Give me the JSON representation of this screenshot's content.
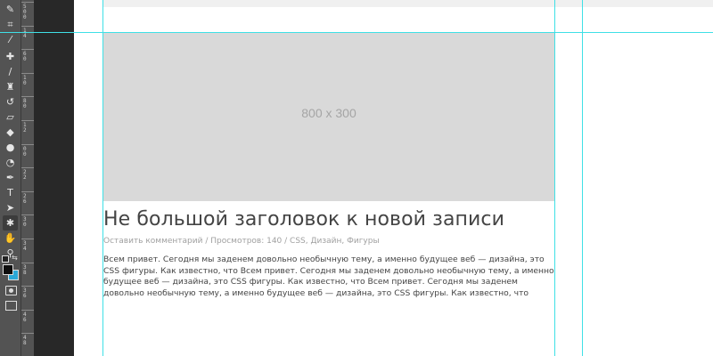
{
  "toolbar": {
    "tools": [
      {
        "name": "brush-small-icon",
        "glyph": "✎"
      },
      {
        "name": "crop-icon",
        "glyph": "⌗"
      },
      {
        "name": "eyedropper-icon",
        "glyph": "⁄"
      },
      {
        "name": "healing-brush-icon",
        "glyph": "✚"
      },
      {
        "name": "brush-icon",
        "glyph": "/"
      },
      {
        "name": "clone-stamp-icon",
        "glyph": "♜"
      },
      {
        "name": "history-brush-icon",
        "glyph": "↺"
      },
      {
        "name": "eraser-icon",
        "glyph": "▱"
      },
      {
        "name": "paint-bucket-icon",
        "glyph": "◆"
      },
      {
        "name": "blur-icon",
        "glyph": "●"
      },
      {
        "name": "dodge-icon",
        "glyph": "◔"
      },
      {
        "name": "pen-icon",
        "glyph": "✒"
      },
      {
        "name": "type-icon",
        "glyph": "T"
      },
      {
        "name": "path-selection-icon",
        "glyph": "➤"
      },
      {
        "name": "custom-shape-icon",
        "glyph": "✱"
      },
      {
        "name": "hand-icon",
        "glyph": "✋"
      },
      {
        "name": "zoom-icon",
        "glyph": "⚲"
      }
    ]
  },
  "ruler": {
    "ticks": [
      {
        "label": "5\n0\n0"
      },
      {
        "label": "1\n4"
      },
      {
        "label": "6\n0"
      },
      {
        "label": "1\n0"
      },
      {
        "label": "8\n0"
      },
      {
        "label": "1\n2"
      },
      {
        "label": "0\n0"
      },
      {
        "label": "2\n2"
      },
      {
        "label": "2\n6"
      },
      {
        "label": "3\n0"
      },
      {
        "label": "3\n4"
      },
      {
        "label": "3\n8"
      },
      {
        "label": "3\n6"
      },
      {
        "label": "4\n6"
      },
      {
        "label": "4\n8"
      }
    ]
  },
  "colors": {
    "foreground": "#0d0d0d",
    "background": "#2aa8d8"
  },
  "placeholder": {
    "label": "800 x 300"
  },
  "post": {
    "title": "Не большой заголовок к новой записи",
    "meta": "Оставить комментарий / Просмотров: 140 / CSS, Дизайн, Фигуры",
    "body": "Всем привет. Сегодня мы заденем довольно необычную тему, а именно будущее веб — дизайна, это CSS фигуры. Как известно, что Всем привет. Сегодня мы заденем довольно необычную тему, а именно будущее веб — дизайна, это CSS фигуры. Как известно, что Всем привет. Сегодня мы заденем довольно необычную тему, а именно будущее веб — дизайна, это CSS фигуры. Как известно, что"
  }
}
